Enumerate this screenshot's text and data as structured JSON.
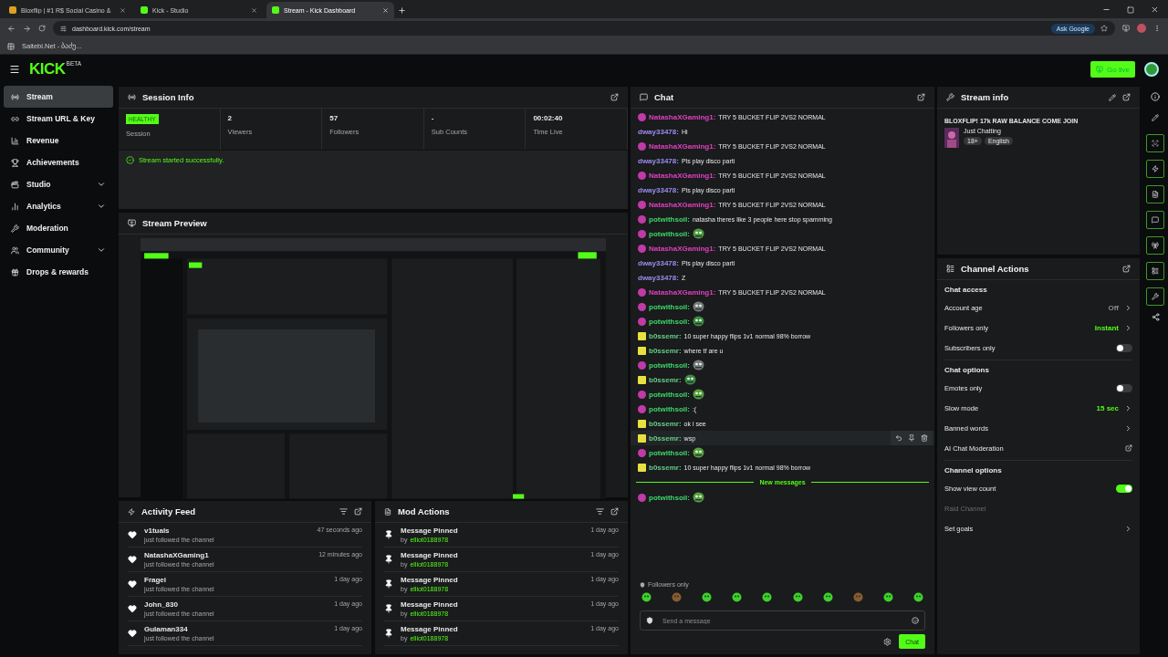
{
  "browser": {
    "tabs": [
      {
        "title": "Bloxflip | #1 R$ Social Casino &",
        "selected": false
      },
      {
        "title": "Kick - Studio",
        "selected": false
      },
      {
        "title": "Stream - Kick Dashboard",
        "selected": true
      }
    ],
    "url": "dashboard.kick.com/stream",
    "ask": "Ask Google",
    "bookmark": "Saitebi.Net - ბაძუ..."
  },
  "header": {
    "logo": "KICK",
    "beta": "BETA",
    "go_live": "Go live"
  },
  "sidebar": {
    "items": [
      {
        "label": "Stream",
        "selected": true,
        "expandable": false
      },
      {
        "label": "Stream URL & Key",
        "selected": false,
        "expandable": false
      },
      {
        "label": "Revenue",
        "selected": false,
        "expandable": false
      },
      {
        "label": "Achievements",
        "selected": false,
        "expandable": false
      },
      {
        "label": "Studio",
        "selected": false,
        "expandable": true
      },
      {
        "label": "Analytics",
        "selected": false,
        "expandable": true
      },
      {
        "label": "Moderation",
        "selected": false,
        "expandable": false
      },
      {
        "label": "Community",
        "selected": false,
        "expandable": true
      },
      {
        "label": "Drops & rewards",
        "selected": false,
        "expandable": false
      }
    ]
  },
  "session": {
    "title": "Session Info",
    "status": "HEALTHY",
    "status_label": "Session",
    "stats": [
      {
        "value": "2",
        "label": "Viewers"
      },
      {
        "value": "57",
        "label": "Followers"
      },
      {
        "value": "-",
        "label": "Sub Counts"
      },
      {
        "value": "00:02:40",
        "label": "Time Live"
      }
    ],
    "message": "Stream started successfully."
  },
  "preview": {
    "title": "Stream Preview",
    "kind": "picture"
  },
  "activity": {
    "title": "Activity Feed",
    "items": [
      {
        "name": "v1tuals",
        "text": "just followed the channel",
        "time": "47 seconds ago"
      },
      {
        "name": "NatashaXGaming1",
        "text": "just followed the channel",
        "time": "12 minutes ago"
      },
      {
        "name": "Fragei",
        "text": "just followed the channel",
        "time": "1 day ago"
      },
      {
        "name": "John_830",
        "text": "just followed the channel",
        "time": "1 day ago"
      },
      {
        "name": "Gulaman334",
        "text": "just followed the channel",
        "time": "1 day ago"
      }
    ]
  },
  "mod_actions": {
    "title": "Mod Actions",
    "items": [
      {
        "action": "Message Pinned",
        "by": "by",
        "user": "elliot0188978",
        "time": "1 day ago"
      },
      {
        "action": "Message Pinned",
        "by": "by",
        "user": "elliot0188978",
        "time": "1 day ago"
      },
      {
        "action": "Message Pinned",
        "by": "by",
        "user": "elliot0188978",
        "time": "1 day ago"
      },
      {
        "action": "Message Pinned",
        "by": "by",
        "user": "elliot0188978",
        "time": "1 day ago"
      },
      {
        "action": "Message Pinned",
        "by": "by",
        "user": "elliot0188978",
        "time": "1 day ago"
      }
    ]
  },
  "chat": {
    "title": "Chat",
    "messages": [
      {
        "user": "NatashaXGaming1:",
        "color": "#e040c0",
        "badge": {
          "kind": "round"
        },
        "kind": "text",
        "text": "TRY 5 BUCKET FLIP 2VS2 NORMAL",
        "hovered": false
      },
      {
        "user": "dway33478:",
        "color": "#9a8cf0",
        "kind": "text",
        "text": "Hi",
        "hovered": false
      },
      {
        "user": "NatashaXGaming1:",
        "color": "#e040c0",
        "badge": {
          "kind": "round"
        },
        "kind": "text",
        "text": "TRY 5 BUCKET FLIP 2VS2 NORMAL",
        "hovered": false
      },
      {
        "user": "dway33478:",
        "color": "#9a8cf0",
        "kind": "text",
        "text": "Pls play disco parti",
        "hovered": false
      },
      {
        "user": "NatashaXGaming1:",
        "color": "#e040c0",
        "badge": {
          "kind": "round"
        },
        "kind": "text",
        "text": "TRY 5 BUCKET FLIP 2VS2 NORMAL",
        "hovered": false
      },
      {
        "user": "dway33478:",
        "color": "#9a8cf0",
        "kind": "text",
        "text": "Pls play disco parti",
        "hovered": false
      },
      {
        "user": "NatashaXGaming1:",
        "color": "#e040c0",
        "badge": {
          "kind": "round"
        },
        "kind": "text",
        "text": "TRY 5 BUCKET FLIP 2VS2 NORMAL",
        "hovered": false
      },
      {
        "user": "potwithsoil:",
        "color": "#3fd66a",
        "badge": {
          "kind": "round"
        },
        "kind": "text",
        "text": "natasha theres like 3 people here stop spamming",
        "hovered": false
      },
      {
        "user": "potwithsoil:",
        "color": "#3fd66a",
        "badge": {
          "kind": "round"
        },
        "kind": "emote",
        "hovered": false
      },
      {
        "user": "NatashaXGaming1:",
        "color": "#e040c0",
        "badge": {
          "kind": "round"
        },
        "kind": "text",
        "text": "TRY 5 BUCKET FLIP 2VS2 NORMAL",
        "hovered": false
      },
      {
        "user": "dway33478:",
        "color": "#9a8cf0",
        "kind": "text",
        "text": "Pls play disco parti",
        "hovered": false
      },
      {
        "user": "dway33478:",
        "color": "#9a8cf0",
        "kind": "text",
        "text": "Z",
        "hovered": false
      },
      {
        "user": "NatashaXGaming1:",
        "color": "#e040c0",
        "badge": {
          "kind": "round"
        },
        "kind": "text",
        "text": "TRY 5 BUCKET FLIP 2VS2 NORMAL",
        "hovered": false
      },
      {
        "user": "potwithsoil:",
        "color": "#3fd66a",
        "badge": {
          "kind": "round"
        },
        "kind": "emote",
        "hovered": false
      },
      {
        "user": "potwithsoil:",
        "color": "#3fd66a",
        "badge": {
          "kind": "round"
        },
        "kind": "emote",
        "hovered": false
      },
      {
        "user": "b0ssemr:",
        "color": "#66cc88",
        "badge": {
          "kind": "square"
        },
        "kind": "text",
        "text": "10 super happy flips 1v1 normal 98% borrow",
        "hovered": false
      },
      {
        "user": "b0ssemr:",
        "color": "#66cc88",
        "badge": {
          "kind": "square"
        },
        "kind": "text",
        "text": "where tf are u",
        "hovered": false
      },
      {
        "user": "potwithsoil:",
        "color": "#3fd66a",
        "badge": {
          "kind": "round"
        },
        "kind": "emote",
        "hovered": false
      },
      {
        "user": "b0ssemr:",
        "color": "#66cc88",
        "badge": {
          "kind": "square"
        },
        "kind": "emote",
        "hovered": false
      },
      {
        "user": "potwithsoil:",
        "color": "#3fd66a",
        "badge": {
          "kind": "round"
        },
        "kind": "emote",
        "hovered": false
      },
      {
        "user": "potwithsoil:",
        "color": "#3fd66a",
        "badge": {
          "kind": "round"
        },
        "kind": "text",
        "text": ":(",
        "hovered": false
      },
      {
        "user": "b0ssemr:",
        "color": "#66cc88",
        "badge": {
          "kind": "square"
        },
        "kind": "text",
        "text": "ok i see",
        "hovered": false
      },
      {
        "user": "b0ssemr:",
        "color": "#66cc88",
        "badge": {
          "kind": "square"
        },
        "kind": "text",
        "text": "wsp",
        "hovered": true
      },
      {
        "user": "potwithsoil:",
        "color": "#3fd66a",
        "badge": {
          "kind": "round"
        },
        "kind": "emote",
        "hovered": false
      },
      {
        "user": "b0ssemr:",
        "color": "#66cc88",
        "badge": {
          "kind": "square"
        },
        "kind": "text",
        "text": "10 super happy flips 1v1 normal 98% borrow",
        "hovered": false
      }
    ],
    "new_label": "New messages",
    "new_messages": [
      {
        "user": "potwithsoil:",
        "color": "#3fd66a",
        "badge": {
          "kind": "round"
        },
        "kind": "emote",
        "hovered": false
      }
    ],
    "followers_only": "Followers only",
    "placeholder": "Send a message",
    "send": "Chat"
  },
  "stream_info": {
    "title": "Stream info",
    "stream_title": "BLOXFLIP! 17k RAW BALANCE COME JOIN",
    "category": "Just Chatting",
    "tags": [
      "18+",
      "English"
    ]
  },
  "channel_actions": {
    "title": "Channel Actions",
    "sections": [
      {
        "heading": "Chat access",
        "rows": [
          {
            "label": "Account age",
            "kind": "link",
            "value": "Off",
            "color": "#8a8d90",
            "disabled": false
          },
          {
            "label": "Followers only",
            "kind": "link",
            "value": "Instant",
            "color": "#53fc18",
            "disabled": false
          },
          {
            "label": "Subscribers only",
            "kind": "toggle",
            "on": false,
            "disabled": false
          }
        ]
      },
      {
        "heading": "Chat options",
        "rows": [
          {
            "label": "Emotes only",
            "kind": "toggle",
            "on": false,
            "disabled": false
          },
          {
            "label": "Slow mode",
            "kind": "link",
            "value": "15 sec",
            "color": "#53fc18",
            "disabled": false
          },
          {
            "label": "Banned words",
            "kind": "link",
            "disabled": false
          },
          {
            "label": "AI Chat Moderation",
            "kind": "external",
            "disabled": false
          }
        ]
      },
      {
        "heading": "Channel options",
        "rows": [
          {
            "label": "Show view count",
            "kind": "toggle",
            "on": true,
            "disabled": false
          },
          {
            "label": "Raid Channel",
            "kind": "plain",
            "disabled": true
          },
          {
            "label": "Set goals",
            "kind": "link",
            "disabled": false
          }
        ]
      }
    ]
  }
}
